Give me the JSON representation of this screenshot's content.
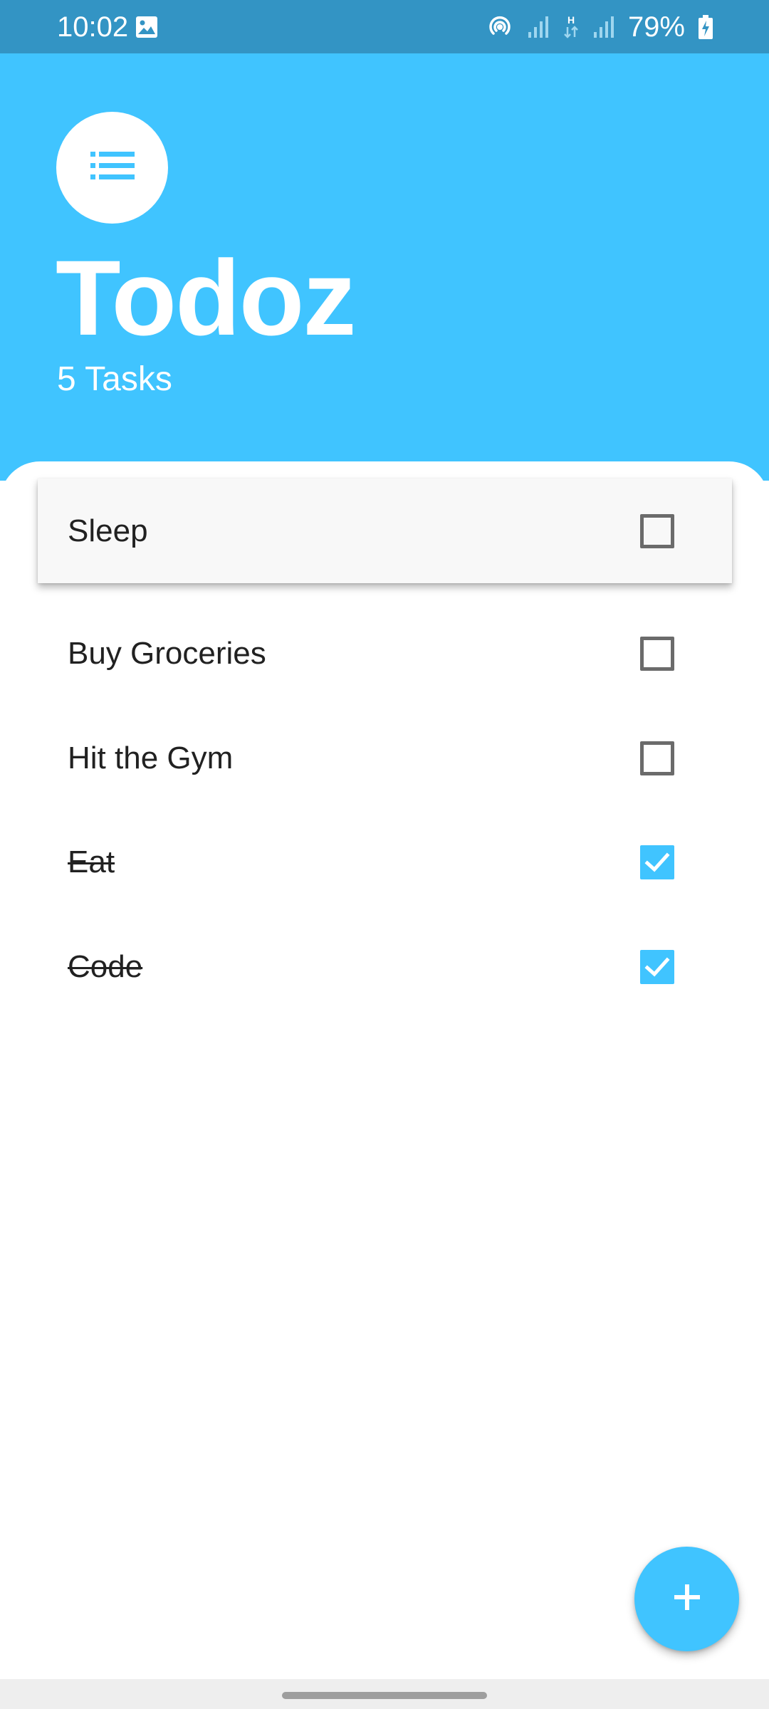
{
  "status_bar": {
    "time": "10:02",
    "battery": "79%",
    "icons": [
      "gallery-icon",
      "hotspot-icon",
      "signal-icon",
      "network-h-icon",
      "signal-icon",
      "battery-charging-icon"
    ]
  },
  "header": {
    "logo_icon": "list-icon",
    "title": "Todoz",
    "task_count": "5 Tasks"
  },
  "tasks": [
    {
      "label": "Sleep",
      "done": false
    },
    {
      "label": "Buy Groceries",
      "done": false
    },
    {
      "label": "Hit the Gym",
      "done": false
    },
    {
      "label": "Eat",
      "done": true
    },
    {
      "label": "Code",
      "done": true
    }
  ],
  "fab": {
    "icon": "plus-icon"
  },
  "colors": {
    "accent": "#40c4ff",
    "status_bar": "#3394c4",
    "checkbox_border": "#6b6b6b",
    "text": "#212121"
  }
}
